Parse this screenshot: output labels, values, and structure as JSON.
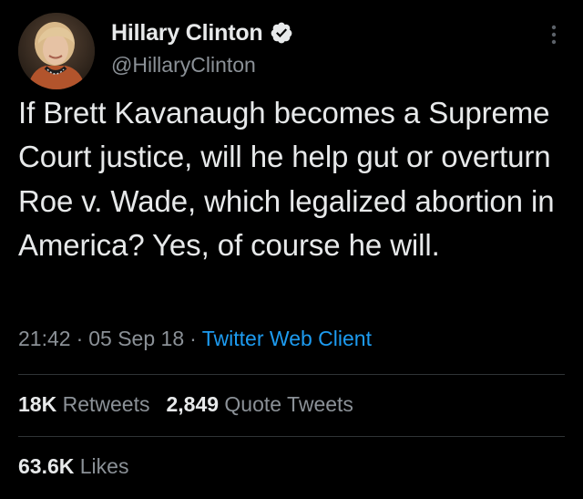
{
  "author": {
    "display_name": "Hillary Clinton",
    "handle": "@HillaryClinton",
    "verified": true
  },
  "tweet": {
    "text": "If Brett Kavanaugh becomes a Supreme Court justice, will he help gut or overturn Roe v. Wade, which legalized abortion in America? Yes, of course he will.",
    "time": "21:42",
    "date": "05 Sep 18",
    "separator": "·",
    "source": "Twitter Web Client"
  },
  "stats": {
    "retweets_count": "18K",
    "retweets_label": "Retweets",
    "quotes_count": "2,849",
    "quotes_label": "Quote Tweets",
    "likes_count": "63.6K",
    "likes_label": "Likes"
  },
  "icons": {
    "verified": "verified-badge-icon",
    "more": "more-options-icon"
  },
  "colors": {
    "background": "#000000",
    "text_primary": "#e7e9ea",
    "text_secondary": "#8b9197",
    "link": "#1d9bf0",
    "divider": "#2f3336"
  }
}
